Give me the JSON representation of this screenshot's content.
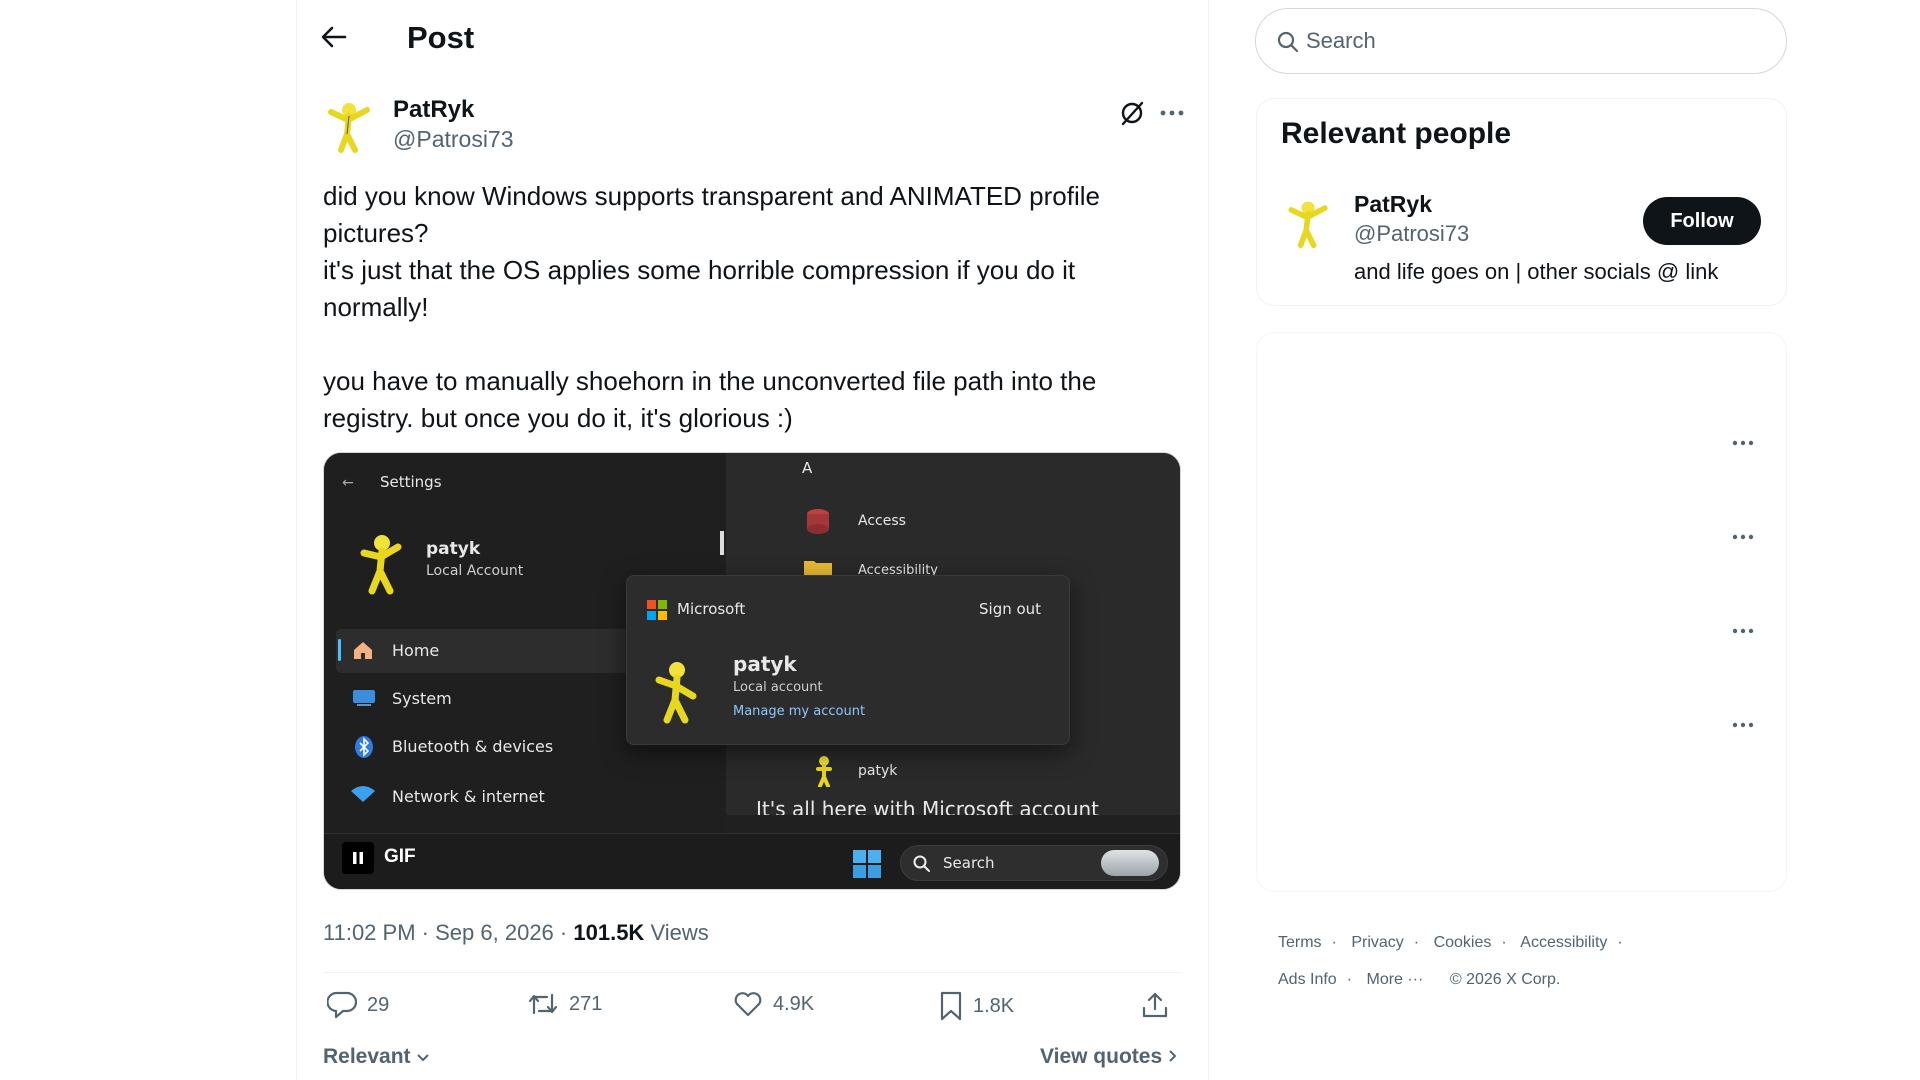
{
  "header": {
    "title": "Post"
  },
  "post": {
    "author_name": "PatRyk",
    "author_handle": "@Patrosi73",
    "text_lines": [
      "did you know Windows supports transparent and ANIMATED profile",
      "pictures?",
      "it's just that the OS applies some horrible compression if you do it",
      "normally!",
      "you have to manually shoehorn in the unconverted file path into the",
      "registry. but once you do it, it's glorious :)"
    ],
    "time": "11:02 PM",
    "date": "Sep 6, 2026",
    "views_count": "101.5K",
    "views_label": "Views",
    "stats": {
      "replies": "29",
      "reposts": "271",
      "likes": "4.9K",
      "bookmarks": "1.8K"
    }
  },
  "media": {
    "gif_label": "GIF",
    "settings_title": "Settings",
    "user_name": "patyk",
    "user_type": "Local Account",
    "nav": [
      "Home",
      "System",
      "Bluetooth & devices",
      "Network & internet"
    ],
    "start_letter": "A",
    "apps": [
      "Access",
      "Accessibility"
    ],
    "popup_brand": "Microsoft",
    "popup_signout": "Sign out",
    "popup_user": "patyk",
    "popup_account": "Local account",
    "popup_manage": "Manage my account",
    "start_user": "patyk",
    "banner": "It's all here with Microsoft account",
    "taskbar_search": "Search"
  },
  "replies_sort": "Relevant",
  "view_quotes": "View quotes",
  "search": {
    "placeholder": "Search"
  },
  "relevant_people": {
    "title": "Relevant people",
    "name": "PatRyk",
    "handle": "@Patrosi73",
    "bio": "and life goes on | other socials @ link",
    "follow": "Follow"
  },
  "footer": {
    "links_row1": [
      "Terms",
      "Privacy",
      "Cookies",
      "Accessibility"
    ],
    "ads_info": "Ads Info",
    "more": "More ···",
    "copyright": "© 2026 X Corp."
  },
  "colors": {
    "text": "#0f1419",
    "secondary": "#536471",
    "border": "#eff3f4",
    "follow_bg": "#0f1419",
    "accent_blue": "#4cc2ff"
  },
  "icons": [
    "back-arrow-icon",
    "grok-icon",
    "more-icon",
    "pause-icon",
    "reply-icon",
    "repost-icon",
    "like-icon",
    "bookmark-icon",
    "share-icon",
    "search-icon",
    "chevron-down-icon",
    "chevron-right-icon"
  ]
}
